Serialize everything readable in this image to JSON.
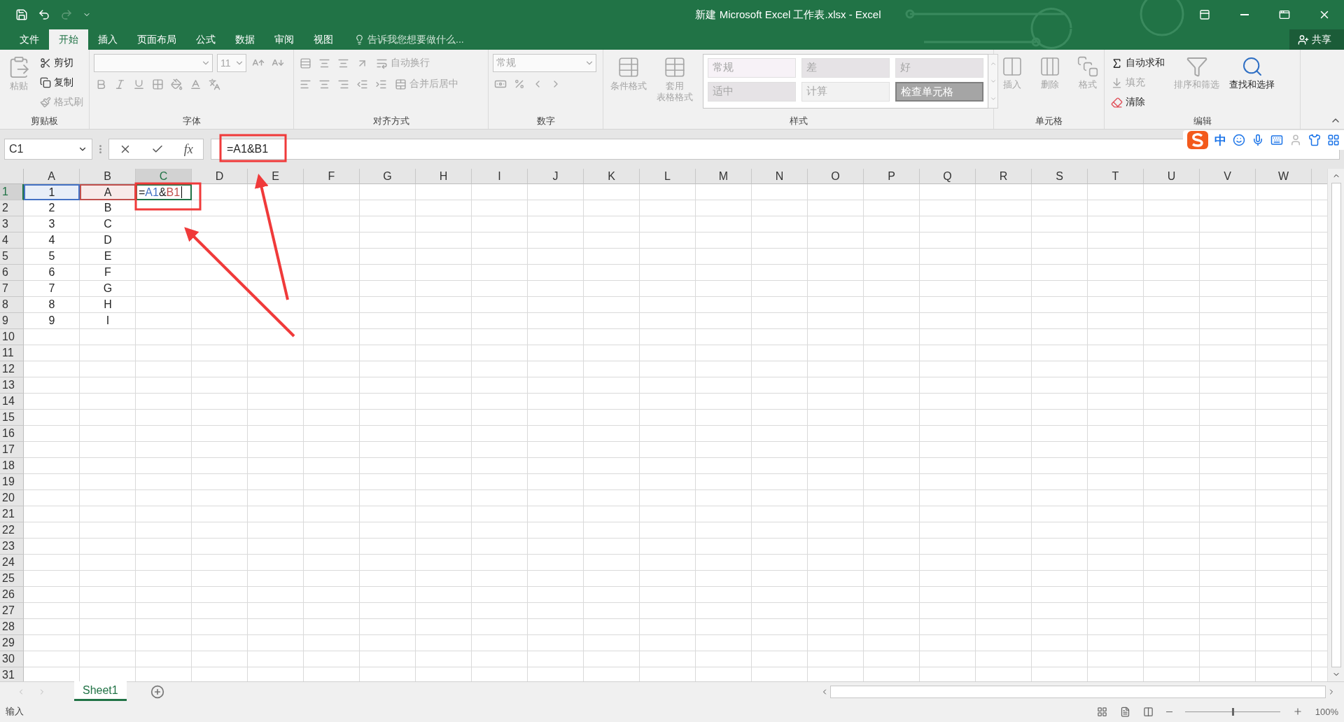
{
  "window": {
    "title": "新建 Microsoft Excel 工作表.xlsx - Excel"
  },
  "ribbon_tabs": [
    {
      "label": "文件",
      "selected": false
    },
    {
      "label": "开始",
      "selected": true
    },
    {
      "label": "插入",
      "selected": false
    },
    {
      "label": "页面布局",
      "selected": false
    },
    {
      "label": "公式",
      "selected": false
    },
    {
      "label": "数据",
      "selected": false
    },
    {
      "label": "审阅",
      "selected": false
    },
    {
      "label": "视图",
      "selected": false
    }
  ],
  "tell_me": "告诉我您想要做什么...",
  "share": "共享",
  "ribbon_groups": [
    {
      "kind": "clipboard",
      "label": "剪贴板",
      "items": [
        {
          "label": "粘贴",
          "disabled": true
        },
        {
          "label": "剪切",
          "disabled": false
        },
        {
          "label": "复制",
          "disabled": false
        },
        {
          "label": "格式刷",
          "disabled": true
        }
      ]
    },
    {
      "kind": "font",
      "label": "字体",
      "size": "11"
    },
    {
      "kind": "alignment",
      "label": "对齐方式",
      "items": [
        {
          "label": "自动换行",
          "disabled": true
        },
        {
          "label": "合并后居中",
          "disabled": true
        }
      ]
    },
    {
      "kind": "number",
      "label": "数字",
      "format": "常规"
    },
    {
      "kind": "styles",
      "label": "样式",
      "items": [
        {
          "label_lines": [
            "条件格式"
          ],
          "disabled": true
        },
        {
          "label_lines": [
            "套用",
            "表格格式"
          ],
          "disabled": true
        }
      ],
      "gallery": [
        {
          "label": "常规",
          "color": "#f7f2f7"
        },
        {
          "label": "差",
          "color": "#e6e3e6"
        },
        {
          "label": "好",
          "color": "#e6e3e6"
        },
        {
          "label": "适中",
          "color": "#e6e3e6"
        },
        {
          "label": "计算",
          "color": "#f2f2f2"
        },
        {
          "label": "检查单元格",
          "color": "#a5a5a5"
        }
      ]
    },
    {
      "kind": "cells",
      "label": "单元格",
      "items": [
        {
          "label": "插入",
          "disabled": true
        },
        {
          "label": "删除",
          "disabled": true
        },
        {
          "label": "格式",
          "disabled": true
        }
      ]
    },
    {
      "kind": "editing",
      "label": "编辑",
      "items": [
        {
          "label": "自动求和",
          "disabled": false
        },
        {
          "label": "填充",
          "disabled": true
        },
        {
          "label": "清除",
          "disabled": false
        },
        {
          "label": "排序和筛选",
          "disabled": true
        },
        {
          "label": "查找和选择",
          "disabled": false
        }
      ]
    }
  ],
  "formula_bar": {
    "name_box": "C1",
    "fx": "fx",
    "formula": "=A1&B1"
  },
  "ime_toolbar": {
    "mode": "中"
  },
  "sheet": {
    "columns": [
      {
        "label": "A",
        "selected": false
      },
      {
        "label": "B",
        "selected": false
      },
      {
        "label": "C",
        "selected": true
      },
      {
        "label": "D",
        "selected": false
      },
      {
        "label": "E",
        "selected": false
      },
      {
        "label": "F",
        "selected": false
      },
      {
        "label": "G",
        "selected": false
      },
      {
        "label": "H",
        "selected": false
      },
      {
        "label": "I",
        "selected": false
      },
      {
        "label": "J",
        "selected": false
      },
      {
        "label": "K",
        "selected": false
      },
      {
        "label": "L",
        "selected": false
      },
      {
        "label": "M",
        "selected": false
      },
      {
        "label": "N",
        "selected": false
      },
      {
        "label": "O",
        "selected": false
      },
      {
        "label": "P",
        "selected": false
      },
      {
        "label": "Q",
        "selected": false
      },
      {
        "label": "R",
        "selected": false
      },
      {
        "label": "S",
        "selected": false
      },
      {
        "label": "T",
        "selected": false
      },
      {
        "label": "U",
        "selected": false
      },
      {
        "label": "V",
        "selected": false
      },
      {
        "label": "W",
        "selected": false
      }
    ],
    "rows": [
      {
        "header": "1",
        "selected": true,
        "cells": [
          {
            "kind": "value",
            "text": "1",
            "color": "#4472c4"
          },
          {
            "kind": "value",
            "text": "A",
            "color": "#c0504d"
          },
          {
            "kind": "formula",
            "parts": [
              {
                "text": "=",
                "color": "#262626"
              },
              {
                "text": "A1",
                "color": "#4472c4"
              },
              {
                "text": "&",
                "color": "#262626"
              },
              {
                "text": "B1",
                "color": "#c0504d"
              }
            ]
          }
        ]
      },
      {
        "header": "2",
        "selected": false,
        "cells": [
          {
            "kind": "value",
            "text": "2"
          },
          {
            "kind": "value",
            "text": "B"
          }
        ]
      },
      {
        "header": "3",
        "selected": false,
        "cells": [
          {
            "kind": "value",
            "text": "3"
          },
          {
            "kind": "value",
            "text": "C"
          }
        ]
      },
      {
        "header": "4",
        "selected": false,
        "cells": [
          {
            "kind": "value",
            "text": "4"
          },
          {
            "kind": "value",
            "text": "D"
          }
        ]
      },
      {
        "header": "5",
        "selected": false,
        "cells": [
          {
            "kind": "value",
            "text": "5"
          },
          {
            "kind": "value",
            "text": "E"
          }
        ]
      },
      {
        "header": "6",
        "selected": false,
        "cells": [
          {
            "kind": "value",
            "text": "6"
          },
          {
            "kind": "value",
            "text": "F"
          }
        ]
      },
      {
        "header": "7",
        "selected": false,
        "cells": [
          {
            "kind": "value",
            "text": "7"
          },
          {
            "kind": "value",
            "text": "G"
          }
        ]
      },
      {
        "header": "8",
        "selected": false,
        "cells": [
          {
            "kind": "value",
            "text": "8"
          },
          {
            "kind": "value",
            "text": "H"
          }
        ]
      },
      {
        "header": "9",
        "selected": false,
        "cells": [
          {
            "kind": "value",
            "text": "9"
          },
          {
            "kind": "value",
            "text": "I"
          }
        ]
      },
      {
        "header": "10",
        "selected": false
      },
      {
        "header": "11",
        "selected": false
      },
      {
        "header": "12",
        "selected": false
      },
      {
        "header": "13",
        "selected": false
      },
      {
        "header": "14",
        "selected": false
      },
      {
        "header": "15",
        "selected": false
      },
      {
        "header": "16",
        "selected": false
      },
      {
        "header": "17",
        "selected": false
      },
      {
        "header": "18",
        "selected": false
      },
      {
        "header": "19",
        "selected": false
      },
      {
        "header": "20",
        "selected": false
      },
      {
        "header": "21",
        "selected": false
      },
      {
        "header": "22",
        "selected": false
      },
      {
        "header": "23",
        "selected": false
      },
      {
        "header": "24",
        "selected": false
      },
      {
        "header": "25",
        "selected": false
      },
      {
        "header": "26",
        "selected": false
      },
      {
        "header": "27",
        "selected": false
      },
      {
        "header": "28",
        "selected": false
      },
      {
        "header": "29",
        "selected": false
      },
      {
        "header": "30",
        "selected": false
      },
      {
        "header": "31",
        "selected": false
      }
    ]
  },
  "sheet_tabs": [
    {
      "label": "Sheet1",
      "selected": true
    }
  ],
  "status_bar": {
    "mode": "输入",
    "zoom": "100%",
    "zoom_slider": {
      "level": 0.5
    }
  }
}
